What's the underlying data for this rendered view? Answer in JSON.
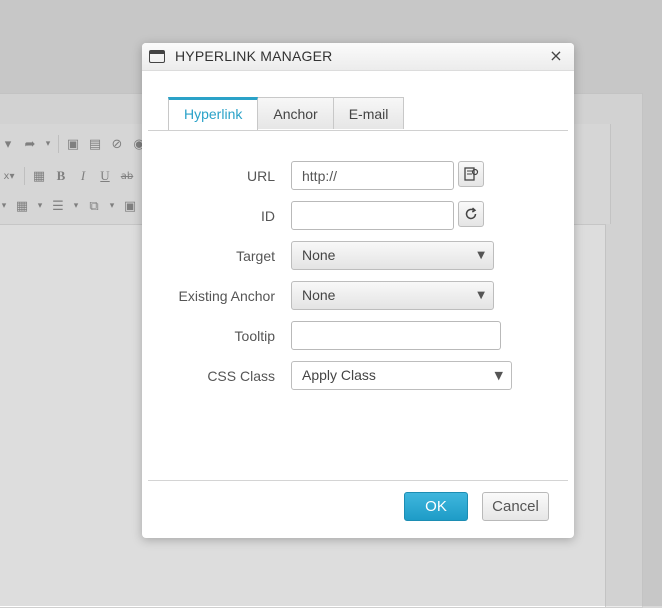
{
  "dialog": {
    "title": "HYPERLINK MANAGER",
    "close_label": "×",
    "tabs": [
      {
        "label": "Hyperlink",
        "active": true
      },
      {
        "label": "Anchor",
        "active": false
      },
      {
        "label": "E-mail",
        "active": false
      }
    ],
    "fields": {
      "url": {
        "label": "URL",
        "value": "http://"
      },
      "id": {
        "label": "ID",
        "value": ""
      },
      "target": {
        "label": "Target",
        "selected": "None"
      },
      "existing_anchor": {
        "label": "Existing Anchor",
        "selected": "None"
      },
      "tooltip": {
        "label": "Tooltip",
        "value": ""
      },
      "css_class": {
        "label": "CSS Class",
        "selected": "Apply Class"
      }
    },
    "buttons": {
      "ok": "OK",
      "cancel": "Cancel"
    },
    "accent_color": "#2aa2c8"
  },
  "editor_toolbar": {
    "format_icons": [
      "B",
      "I",
      "U",
      "ab"
    ],
    "icon_names": [
      "redo-icon",
      "image-icon",
      "document-manager-icon",
      "flash-icon",
      "media-icon",
      "bold-icon",
      "italic-icon",
      "underline-icon",
      "strikethrough-icon",
      "table-icon",
      "list-icon",
      "template-icon",
      "image-manager-icon"
    ]
  }
}
